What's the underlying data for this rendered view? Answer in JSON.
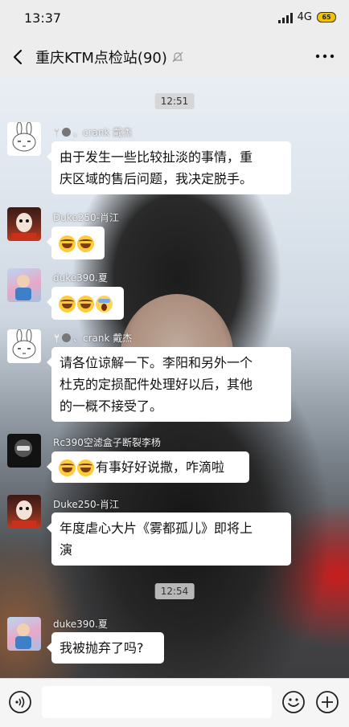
{
  "status": {
    "time": "13:37",
    "network": "4G",
    "battery": "65"
  },
  "nav": {
    "title": "重庆KTM点检站(90)"
  },
  "chat": {
    "timestamps": [
      "12:51",
      "12:54"
    ],
    "messages": [
      {
        "sender": "、crank 戴杰",
        "avatar": "rabbit",
        "parts": [
          "由于发生一些比较扯淡的事情，重",
          "庆区域的售后问题，我决定脱手。"
        ]
      },
      {
        "sender": "Duke250-肖江",
        "avatar": "doll",
        "emojis": [
          "laugh",
          "laugh"
        ]
      },
      {
        "sender": "duke390.夏",
        "avatar": "kid",
        "emojis": [
          "laugh",
          "laugh",
          "scream"
        ]
      },
      {
        "sender": "、crank 戴杰",
        "avatar": "rabbit",
        "parts": [
          "请各位谅解一下。李阳和另外一个",
          "杜克的定损配件处理好以后，其他",
          "的一概不接受了。"
        ]
      },
      {
        "sender": "Rc390空滤盒子断裂李杨",
        "avatar": "helmet",
        "text": "有事好好说撒，咋滴啦"
      },
      {
        "sender": "Duke250-肖江",
        "avatar": "doll",
        "parts": [
          "年度虐心大片《雾都孤儿》即将上",
          "演"
        ]
      },
      {
        "sender": "duke390.夏",
        "avatar": "kid",
        "text": "我被抛弃了吗?"
      }
    ]
  },
  "input": {
    "placeholder": ""
  },
  "icons": {
    "back": "back-arrow-icon",
    "mute": "bell-off-icon",
    "more": "more-icon",
    "voice": "voice-icon",
    "emoji": "emoji-icon",
    "plus": "plus-icon"
  },
  "colors": {
    "background": "#ededed",
    "bubble": "#ffffff",
    "battery": "#f2c300"
  }
}
